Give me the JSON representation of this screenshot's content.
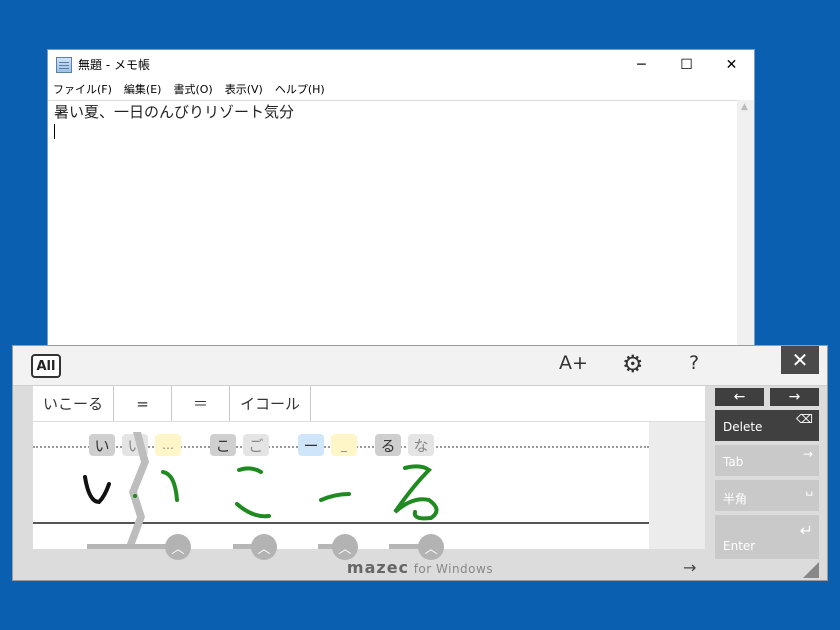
{
  "notepad": {
    "title": "無題 - メモ帳",
    "controls": {
      "minimize": "─",
      "maximize": "☐",
      "close": "✕"
    },
    "menu": [
      "ファイル(F)",
      "編集(E)",
      "書式(O)",
      "表示(V)",
      "ヘルプ(H)"
    ],
    "text": "暑い夏、一日のんびりリゾート気分"
  },
  "ime": {
    "all_label": "All",
    "font_size_label": "A+",
    "help_label": "?",
    "close_label": "✕",
    "candidates": [
      "いこーる",
      "=",
      "＝",
      "イコール"
    ],
    "chips": [
      {
        "text": "い",
        "style": "main"
      },
      {
        "text": "い",
        "style": "sub"
      },
      {
        "text": "…",
        "style": "yel"
      },
      {
        "text": "こ",
        "style": "main"
      },
      {
        "text": "ご",
        "style": "sub"
      },
      {
        "text": "ー",
        "style": "blue"
      },
      {
        "text": "_",
        "style": "yel"
      },
      {
        "text": "る",
        "style": "main"
      },
      {
        "text": "な",
        "style": "sub"
      }
    ],
    "keys": {
      "left_arrow": "←",
      "right_arrow": "→",
      "delete": "Delete",
      "tab": "Tab",
      "hankaku": "半角",
      "enter": "Enter"
    },
    "brand_main": "mazec",
    "brand_sub": "for Windows",
    "next_arrow": "→",
    "stroke_color": "#1f8a1f"
  }
}
